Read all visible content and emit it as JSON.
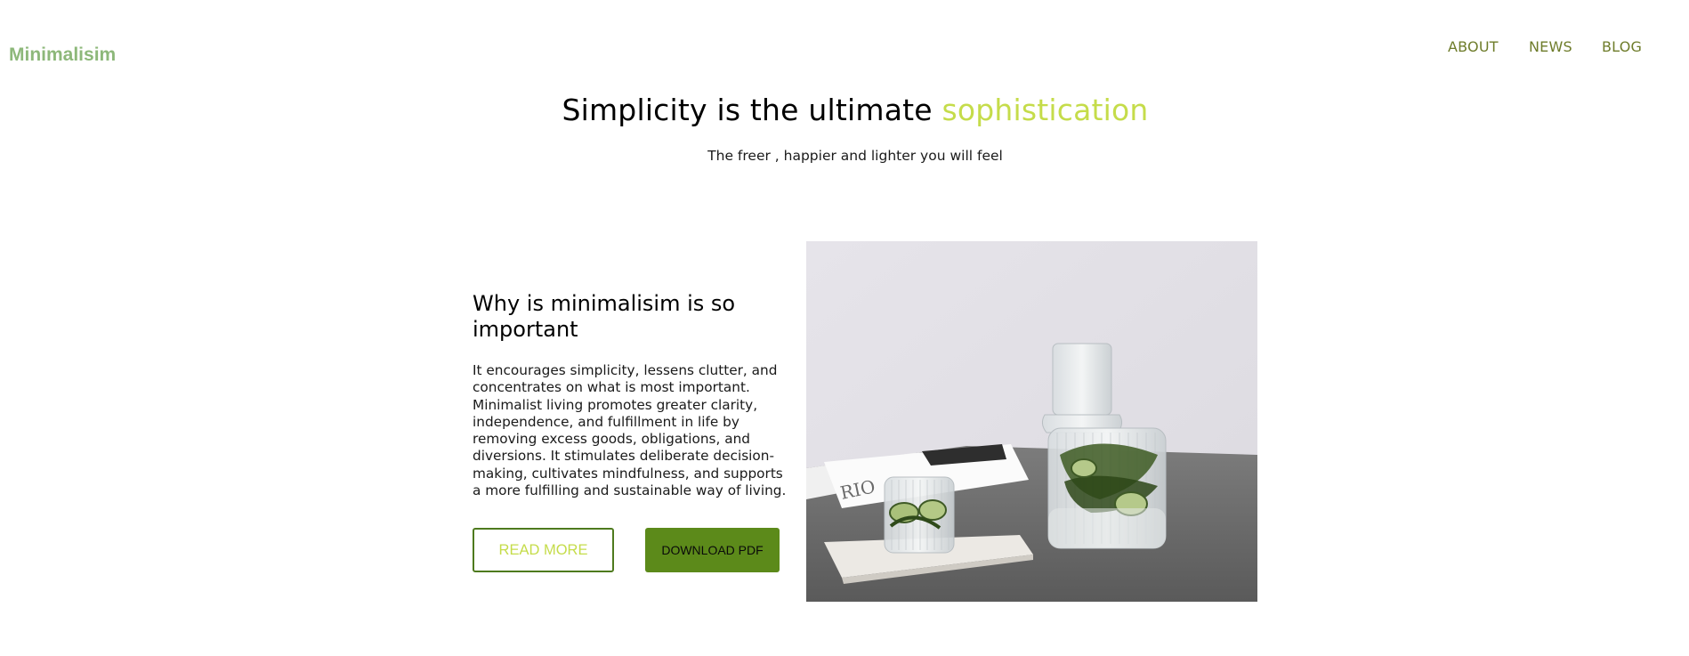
{
  "header": {
    "brand": "Minimalisim",
    "nav": [
      "ABOUT",
      "NEWS",
      "BLOG"
    ]
  },
  "hero": {
    "title_main": "Simplicity is the ultimate ",
    "title_accent": "sophistication",
    "subtitle": "The freer , happier and lighter you will feel"
  },
  "feature": {
    "heading": "Why is minimalisim is so important",
    "body": "It encourages simplicity, lessens clutter, and concentrates on what is most important. Minimalist living promotes greater clarity, independence, and fulfillment in life by removing excess goods, obligations, and diversions. It stimulates deliberate decision-making, cultivates mindfulness, and supports a more fulfilling and sustainable way of living.",
    "read_more": "READ MORE",
    "download": "DOWNLOAD PDF",
    "image_alt": "glass-carafe-with-cucumber-water-image"
  },
  "colors": {
    "brand": "#8db87a",
    "nav": "#6e7c2a",
    "accent": "#c5dc4a",
    "button_green": "#5c8a1a",
    "button_border": "#4e7a1e"
  }
}
